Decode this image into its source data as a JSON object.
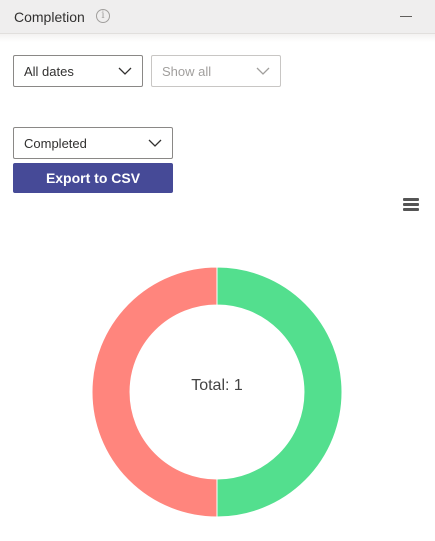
{
  "header": {
    "title": "Completion",
    "info_glyph": "i"
  },
  "filters": {
    "dates": {
      "value": "All dates",
      "icon": "chevron-down-icon"
    },
    "show": {
      "value": "Show all",
      "icon": "chevron-down-icon",
      "disabled": true
    },
    "status": {
      "value": "Completed",
      "icon": "chevron-down-icon"
    }
  },
  "actions": {
    "export_label": "Export to CSV"
  },
  "chart_data": {
    "type": "pie",
    "variant": "donut",
    "categories": [
      "",
      ""
    ],
    "values": [
      1,
      1
    ],
    "colors": [
      "#53df8e",
      "#ff857d"
    ],
    "center_text": "Total: 1"
  },
  "colors": {
    "accent": "#464a97",
    "header_bg": "#efeeee"
  }
}
